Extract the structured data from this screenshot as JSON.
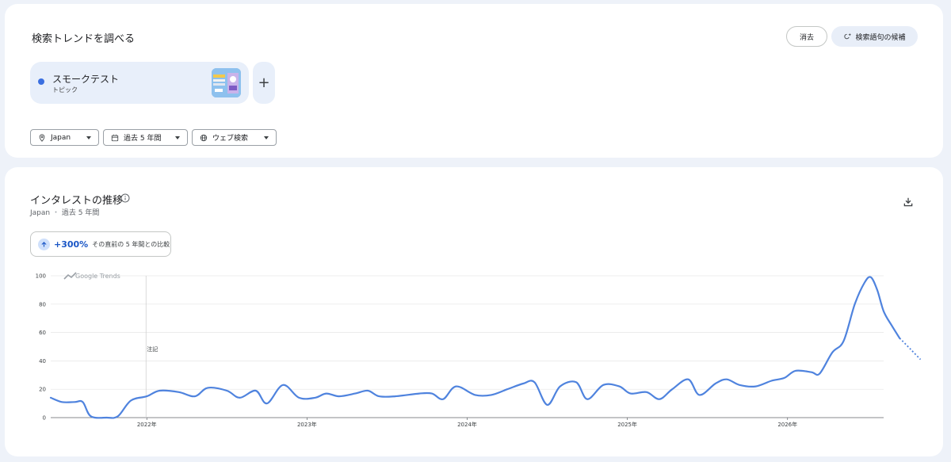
{
  "explore": {
    "title": "検索トレンドを調べる",
    "clear_label": "消去",
    "suggest_label": "検索語句の候補",
    "term": {
      "name": "スモークテスト",
      "type": "トピック",
      "color": "#3b6fe0"
    },
    "add_label": "+",
    "filters": {
      "region": "Japan",
      "time": "過去 5 年間",
      "search_type": "ウェブ検索"
    }
  },
  "interest": {
    "title": "インタレストの推移",
    "subtitle_region": "Japan",
    "subtitle_separator": "・",
    "subtitle_time": "過去 5 年間",
    "change_value": "+300%",
    "change_label": "その直前の 5 年間との比較",
    "watermark": "Google Trends",
    "note_marker": "注記"
  },
  "colors": {
    "line": "#4f83de",
    "accent": "#1a56c6",
    "chip": "#e8effa"
  },
  "chart_data": {
    "type": "line",
    "title": "インタレストの推移",
    "xlabel": "",
    "ylabel": "",
    "ylim": [
      0,
      100
    ],
    "yticks": [
      "0",
      "20",
      "40",
      "60",
      "80",
      "100"
    ],
    "xtick_labels": [
      "2022年",
      "2023年",
      "2024年",
      "2025年",
      "2026年"
    ],
    "xtick_years": [
      2022,
      2023,
      2024,
      2025,
      2026
    ],
    "xlim": [
      2021.4,
      2026.6
    ],
    "grid": true,
    "legend": "none",
    "series": [
      {
        "points": [
          [
            2021.4,
            14
          ],
          [
            2021.47,
            11
          ],
          [
            2021.55,
            11
          ],
          [
            2021.6,
            11
          ],
          [
            2021.65,
            1
          ],
          [
            2021.75,
            0
          ],
          [
            2021.82,
            1
          ],
          [
            2021.9,
            12
          ],
          [
            2022.0,
            15
          ],
          [
            2022.08,
            19
          ],
          [
            2022.2,
            18
          ],
          [
            2022.3,
            15
          ],
          [
            2022.38,
            21
          ],
          [
            2022.5,
            19
          ],
          [
            2022.58,
            14
          ],
          [
            2022.68,
            19
          ],
          [
            2022.75,
            10
          ],
          [
            2022.85,
            23
          ],
          [
            2022.95,
            14
          ],
          [
            2023.05,
            14
          ],
          [
            2023.12,
            17
          ],
          [
            2023.2,
            15
          ],
          [
            2023.3,
            17
          ],
          [
            2023.38,
            19
          ],
          [
            2023.45,
            15
          ],
          [
            2023.55,
            15
          ],
          [
            2023.7,
            17
          ],
          [
            2023.78,
            17
          ],
          [
            2023.85,
            13
          ],
          [
            2023.93,
            22
          ],
          [
            2024.05,
            16
          ],
          [
            2024.15,
            16
          ],
          [
            2024.25,
            20
          ],
          [
            2024.35,
            24
          ],
          [
            2024.42,
            25
          ],
          [
            2024.5,
            9
          ],
          [
            2024.58,
            22
          ],
          [
            2024.68,
            25
          ],
          [
            2024.75,
            13
          ],
          [
            2024.85,
            23
          ],
          [
            2024.95,
            22
          ],
          [
            2025.02,
            17
          ],
          [
            2025.12,
            18
          ],
          [
            2025.2,
            13
          ],
          [
            2025.28,
            20
          ],
          [
            2025.38,
            27
          ],
          [
            2025.45,
            16
          ],
          [
            2025.55,
            24
          ],
          [
            2025.62,
            27
          ],
          [
            2025.7,
            23
          ],
          [
            2025.8,
            22
          ],
          [
            2025.9,
            26
          ],
          [
            2025.98,
            28
          ],
          [
            2026.05,
            33
          ],
          [
            2026.15,
            32
          ],
          [
            2026.2,
            31
          ],
          [
            2026.28,
            46
          ],
          [
            2026.35,
            54
          ],
          [
            2026.42,
            80
          ],
          [
            2026.48,
            95
          ],
          [
            2026.52,
            99
          ],
          [
            2026.56,
            90
          ],
          [
            2026.6,
            75
          ],
          [
            2026.65,
            65
          ],
          [
            2026.7,
            56
          ]
        ],
        "partial": [
          [
            2026.7,
            56
          ],
          [
            2026.77,
            48
          ],
          [
            2026.83,
            41
          ]
        ]
      }
    ]
  }
}
